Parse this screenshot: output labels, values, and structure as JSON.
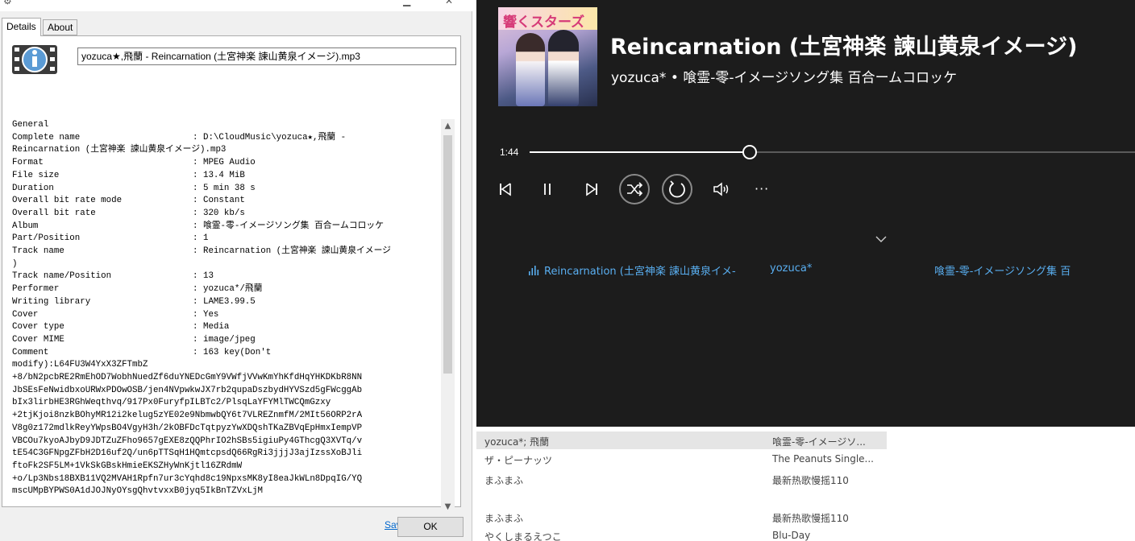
{
  "dialog": {
    "tabs": [
      {
        "label": "Details"
      },
      {
        "label": "About"
      }
    ],
    "filename": "yozuca★,飛蘭 - Reincarnation (土宮神楽 諫山黄泉イメージ).mp3",
    "report_heading": "General",
    "report": [
      {
        "k": "Complete name",
        "v": ": D:\\CloudMusic\\yozuca★,飛蘭 -"
      },
      {
        "k": "Reincarnation (土宮神楽 諫山黄泉イメージ).mp3",
        "v": ""
      },
      {
        "k": "Format",
        "v": ": MPEG Audio"
      },
      {
        "k": "File size",
        "v": ": 13.4 MiB"
      },
      {
        "k": "Duration",
        "v": ": 5 min 38 s"
      },
      {
        "k": "Overall bit rate mode",
        "v": ": Constant"
      },
      {
        "k": "Overall bit rate",
        "v": ": 320 kb/s"
      },
      {
        "k": "Album",
        "v": ": 喰霊-零-イメージソング集 百合ームコロッケ"
      },
      {
        "k": "Part/Position",
        "v": ": 1"
      },
      {
        "k": "Track name",
        "v": ": Reincarnation (土宮神楽 諫山黄泉イメージ"
      },
      {
        "k": ")",
        "v": ""
      },
      {
        "k": "Track name/Position",
        "v": ": 13"
      },
      {
        "k": "Performer",
        "v": ": yozuca*/飛蘭"
      },
      {
        "k": "Writing library",
        "v": ": LAME3.99.5"
      },
      {
        "k": "Cover",
        "v": ": Yes"
      },
      {
        "k": "Cover type",
        "v": ": Media"
      },
      {
        "k": "Cover MIME",
        "v": ": image/jpeg"
      },
      {
        "k": "Comment",
        "v": ": 163 key(Don't"
      }
    ],
    "comment_lines": [
      "modify):L64FU3W4YxX3ZFTmbZ",
      "+8/bN2pcbRE2RmEhOD7WobhNuedZf6duYNEDcGmY9VWfjVVwKmYhKfdHqYHKDKbR8NN",
      "JbSEsFeNwidbxoURWxPDOwOSB/jen4NVpwkwJX7rb2qupaDszbydHYVSzd5gFWcggAb",
      "bIx3lirbHE3RGhWeqthvq/917Px0FuryfpILBTc2/PlsqLaYFYMlTWCQmGzxy",
      "+2tjKjoi8nzkBOhyMR12i2kelug5zYE02e9NbmwbQY6t7VLREZnmfM/2MIt56ORP2rA",
      "V8g0z172mdlkReyYWpsBO4VgyH3h/2kOBFDcTqtpyzYwXDQshTKaZBVqEpHmxIempVP",
      "VBCOu7kyoAJbyD9JDTZuZFho9657gEXE8zQQPhrIO2hSBs5igiuPy4GThcgQ3XVTq/v",
      "tE54C3GFNpgZFbH2D16uf2Q/un6pTTSqH1HQmtcpsdQ66RgRi3jjjJ3ajIzssXoBJli",
      "ftoFk2SF5LM+1VkSkGBskHmieEKSZHyWnKjtl16ZRdmW",
      "+o/Lp3Nbs18BXB11VQ2MVAH1Rpfn7ur3cYqhd8c19NpxsMK8yI8eaJkWLn8DpqIG/YQ",
      "mscUMpBYPWS0A1dJOJNyOYsgQhvtvxxB0jyq5IkBnTZVxLjM"
    ],
    "save_link": "Save to text file",
    "ok_label": "OK"
  },
  "player": {
    "album_art_text": "響くスターズ",
    "title": "Reincarnation (土宮神楽 諫山黄泉イメージ)",
    "subtitle": "yozuca* • 喰霊-零-イメージソング集 百合ームコロッケ",
    "current_time": "1:44",
    "more_label": "···",
    "queue": {
      "title": "Reincarnation (土宮神楽 諫山黄泉イメ-",
      "artist": "yozuca*",
      "album": "喰霊-零-イメージソング集 百"
    },
    "accent_color": "#59aef0",
    "background_color": "#1c1c1c"
  },
  "tracklist": {
    "rows": [
      {
        "artist": "yozuca*; 飛蘭",
        "album": "喰霊-零-イメージソ..."
      },
      {
        "artist": "ザ・ピーナッツ",
        "album": "The Peanuts Single..."
      },
      {
        "artist": "まふまふ",
        "album": "最新热歌慢摇110"
      },
      {
        "artist": "まふまふ",
        "album": "最新热歌慢摇110"
      },
      {
        "artist": "やくしまるえつこ",
        "album": "Blu-Day"
      }
    ]
  }
}
